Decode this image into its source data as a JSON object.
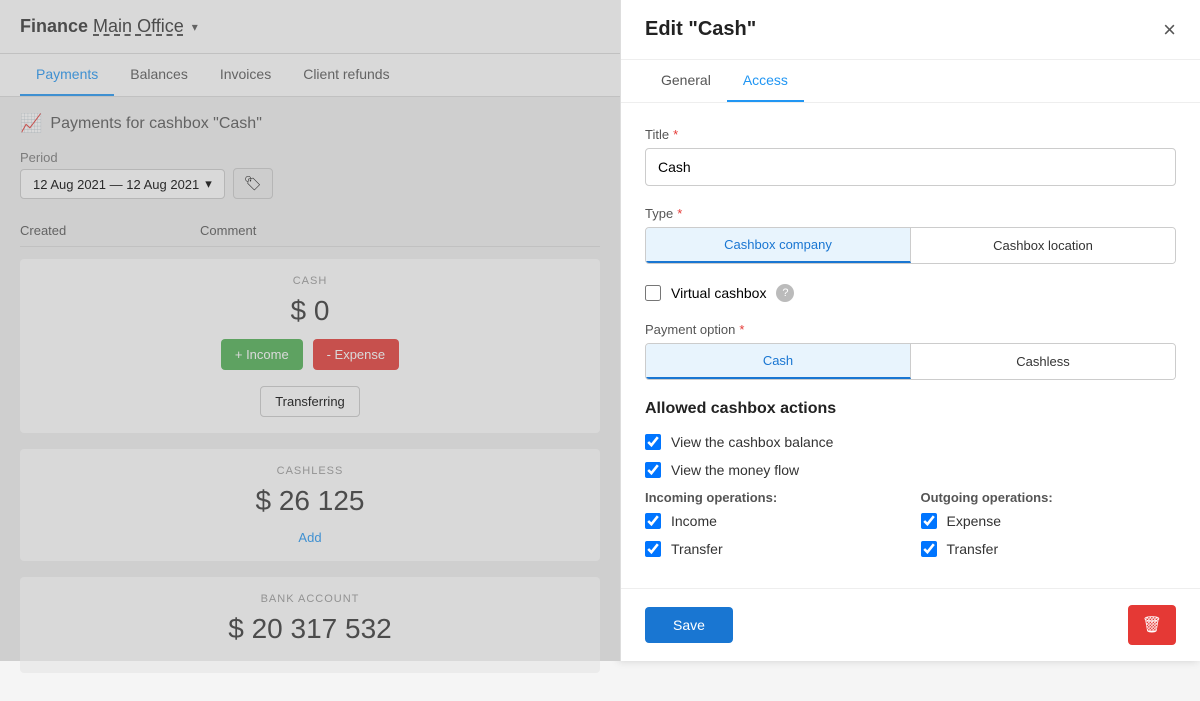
{
  "left": {
    "header": {
      "app": "Finance",
      "office": "Main Office",
      "dropdown": "▾"
    },
    "tabs": [
      {
        "label": "Payments",
        "active": true
      },
      {
        "label": "Balances",
        "active": false
      },
      {
        "label": "Invoices",
        "active": false
      },
      {
        "label": "Client refunds",
        "active": false
      }
    ],
    "payments_header": "Payments for cashbox \"Cash\"",
    "period_label": "Period",
    "period_value": "12 Aug 2021 — 12 Aug 2021",
    "table_cols": [
      "Created",
      "Comment"
    ],
    "cashbox_cash": {
      "label": "CASH",
      "amount": "$ 0",
      "btn_income": "+ Income",
      "btn_expense": "- Expense",
      "btn_transfer": "Transferring"
    },
    "cashbox_cashless": {
      "label": "CASHLESS",
      "amount": "$ 26 125",
      "add_link": "Add"
    },
    "cashbox_bank": {
      "label": "BANK ACCOUNT",
      "amount": "$ 20 317 532"
    }
  },
  "modal": {
    "title": "Edit \"Cash\"",
    "close_label": "×",
    "tabs": [
      {
        "label": "General",
        "active": false
      },
      {
        "label": "Access",
        "active": true
      }
    ],
    "title_label": "Title",
    "title_value": "Cash",
    "type_label": "Type",
    "type_options": [
      {
        "label": "Cashbox company",
        "selected": true
      },
      {
        "label": "Cashbox location",
        "selected": false
      }
    ],
    "virtual_cashbox_label": "Virtual cashbox",
    "payment_option_label": "Payment option",
    "payment_options": [
      {
        "label": "Cash",
        "selected": true
      },
      {
        "label": "Cashless",
        "selected": false
      }
    ],
    "allowed_actions_title": "Allowed cashbox actions",
    "actions": [
      {
        "label": "View the cashbox balance",
        "checked": true
      },
      {
        "label": "View the money flow",
        "checked": true
      }
    ],
    "incoming_label": "Incoming operations:",
    "outgoing_label": "Outgoing operations:",
    "incoming_ops": [
      {
        "label": "Income",
        "checked": true
      },
      {
        "label": "Transfer",
        "checked": true
      }
    ],
    "outgoing_ops": [
      {
        "label": "Expense",
        "checked": true
      },
      {
        "label": "Transfer",
        "checked": true
      }
    ],
    "save_label": "Save",
    "delete_icon": "🗑"
  }
}
